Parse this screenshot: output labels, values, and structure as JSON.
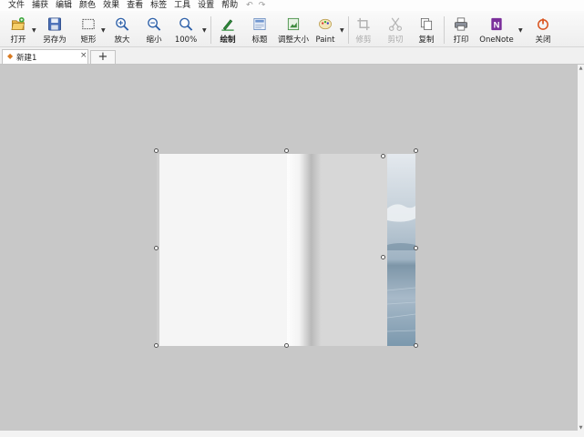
{
  "menubar": {
    "items": [
      "文件",
      "捕获",
      "编辑",
      "颜色",
      "效果",
      "查看",
      "标签",
      "工具",
      "设置",
      "帮助"
    ],
    "undo_icon": "undo-icon",
    "redo_icon": "redo-icon"
  },
  "toolbar": {
    "open": "打开",
    "save_as": "另存为",
    "rectangle": "矩形",
    "zoom_in": "放大",
    "zoom_out": "缩小",
    "zoom_level": "100%",
    "draw": "绘制",
    "title": "标题",
    "resize": "调整大小",
    "paint": "Paint",
    "crop": "修剪",
    "cut": "剪切",
    "copy": "复制",
    "print": "打印",
    "onenote": "OneNote",
    "close": "关闭"
  },
  "tabs": {
    "active_tab": "新建1",
    "close_symbol": "×",
    "add_symbol": "+"
  },
  "colors": {
    "canvas_bg": "#c8c8c8",
    "accent_orange": "#d97a20",
    "onenote_purple": "#7b2f9b"
  }
}
